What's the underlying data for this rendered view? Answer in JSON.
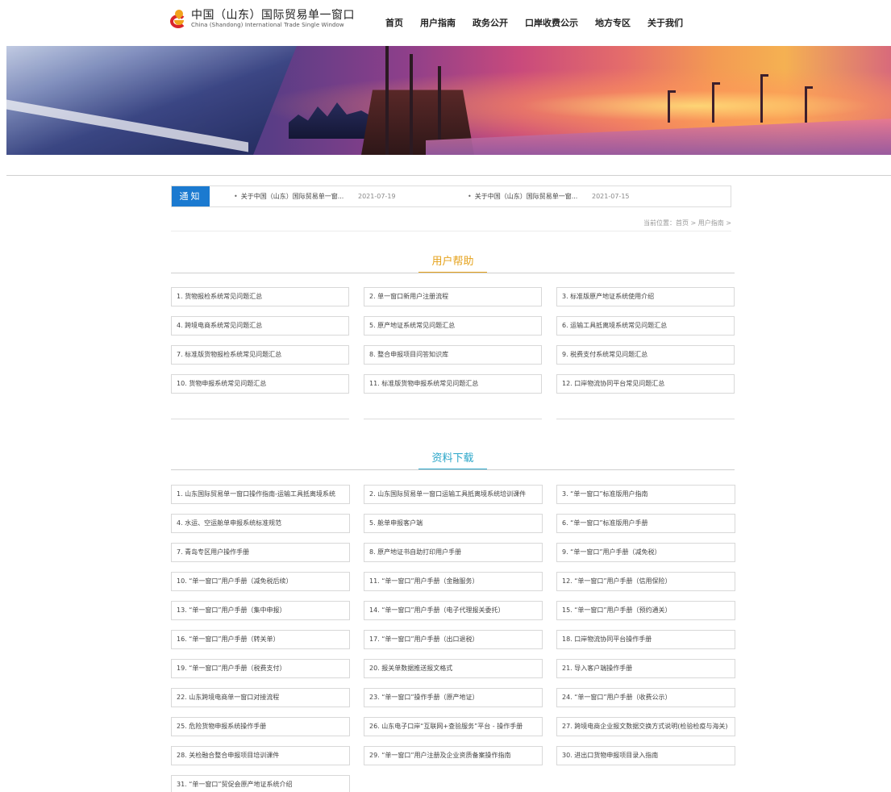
{
  "header": {
    "logo_cn": "中国（山东）国际贸易单一窗口",
    "logo_en": "China (Shandong) International Trade Single Window",
    "nav": [
      "首页",
      "用户指南",
      "政务公开",
      "口岸收费公示",
      "地方专区",
      "关于我们"
    ]
  },
  "notice": {
    "label": "通知",
    "items": [
      {
        "text": "关于中国（山东）国际贸易单一窗...",
        "date": "2021-07-19"
      },
      {
        "text": "关于中国（山东）国际贸易单一窗...",
        "date": "2021-07-15"
      }
    ]
  },
  "breadcrumb": "当前位置：首页 > 用户指南 >",
  "help": {
    "title": "用户帮助",
    "items": [
      "1. 货物报检系统常见问题汇总",
      "2. 单一窗口新用户注册流程",
      "3. 标准版原产地证系统使用介绍",
      "4. 跨境电商系统常见问题汇总",
      "5. 原产地证系统常见问题汇总",
      "6. 运输工具抵离境系统常见问题汇总",
      "7. 标准版货物报检系统常见问题汇总",
      "8. 整合申报项目问答知识库",
      "9. 税费支付系统常见问题汇总",
      "10. 货物申报系统常见问题汇总",
      "11. 标准版货物申报系统常见问题汇总",
      "12. 口岸物流协同平台常见问题汇总"
    ]
  },
  "download": {
    "title": "资料下载",
    "items": [
      "1. 山东国际贸易单一窗口操作指南-运输工具抵离境系统",
      "2. 山东国际贸易单一窗口运输工具抵离境系统培训课件",
      "3. “单一窗口”标准版用户指南",
      "4. 水运、空运舱单申报系统标准规范",
      "5. 舱单申报客户端",
      "6. “单一窗口”标准版用户手册",
      "7. 青岛专区用户操作手册",
      "8. 原产地证书自助打印用户手册",
      "9. “单一窗口”用户手册（减免税）",
      "10. “单一窗口”用户手册（减免税后续）",
      "11. “单一窗口”用户手册（金融服务）",
      "12. “单一窗口”用户手册（信用保险）",
      "13. “单一窗口”用户手册（集中申报）",
      "14. “单一窗口”用户手册（电子代理报关委托）",
      "15. “单一窗口”用户手册（预约通关）",
      "16. “单一窗口”用户手册（转关单）",
      "17. “单一窗口”用户手册（出口退税）",
      "18. 口岸物流协同平台操作手册",
      "19. “单一窗口”用户手册（税费支付）",
      "20. 报关单数据推送报文格式",
      "21. 导入客户端操作手册",
      "22. 山东跨境电商单一窗口对接流程",
      "23. “单一窗口”操作手册（原产地证）",
      "24. “单一窗口”用户手册（收费公示）",
      "25. 危险货物申报系统操作手册",
      "26. 山东电子口岸“互联网+查验服务”平台 - 操作手册",
      "27. 跨境电商企业报文数据交换方式说明(检验检疫与海关)",
      "28. 关检融合整合申报项目培训课件",
      "29. “单一窗口”用户注册及企业资质备案操作指南",
      "30. 进出口货物申报项目录入指南",
      "31. “单一窗口”贸促会原产地证系统介绍"
    ]
  }
}
